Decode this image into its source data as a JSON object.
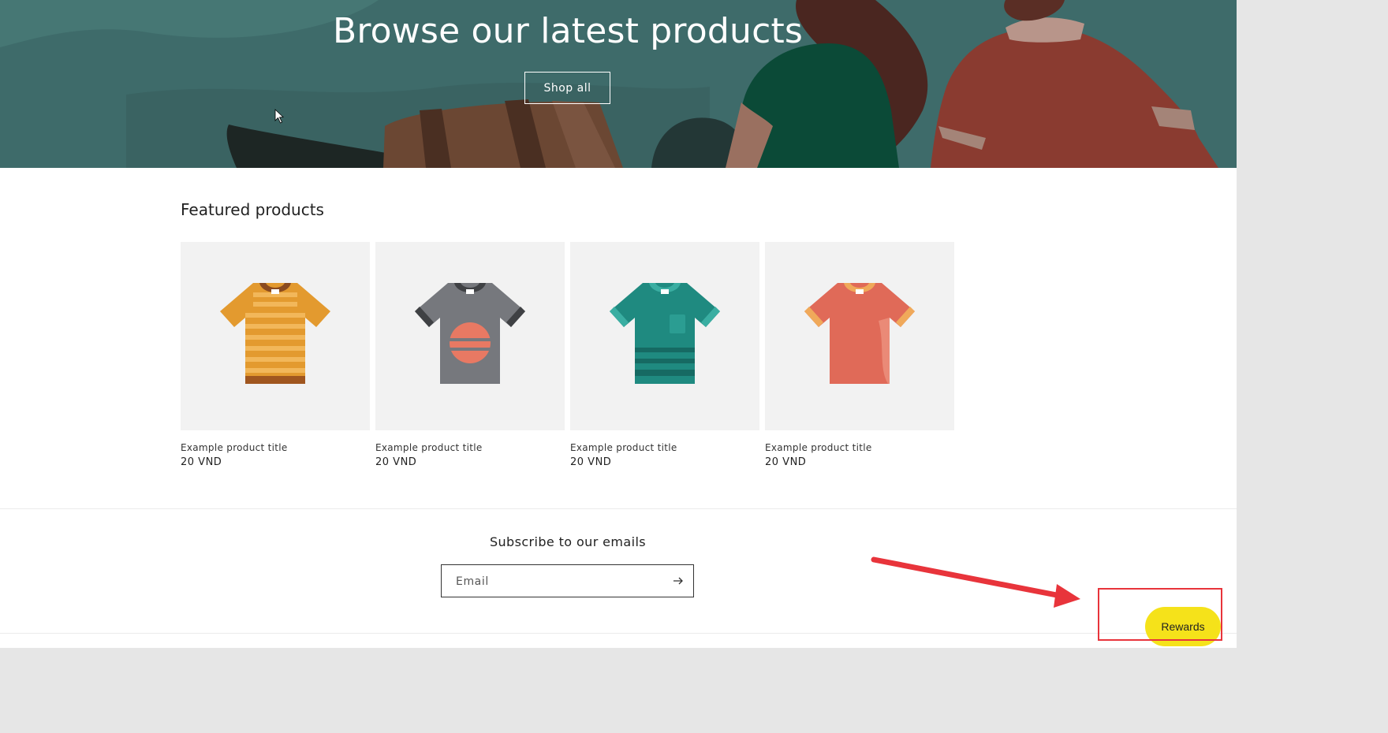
{
  "hero": {
    "title": "Browse our latest products",
    "button_label": "Shop all"
  },
  "featured": {
    "title": "Featured products",
    "products": [
      {
        "title": "Example product title",
        "price": "20 VND",
        "shirt": "striped-orange-shirt-icon"
      },
      {
        "title": "Example product title",
        "price": "20 VND",
        "shirt": "gray-sunset-shirt-icon"
      },
      {
        "title": "Example product title",
        "price": "20 VND",
        "shirt": "teal-pocket-shirt-icon"
      },
      {
        "title": "Example product title",
        "price": "20 VND",
        "shirt": "coral-shirt-icon"
      }
    ]
  },
  "newsletter": {
    "title": "Subscribe to our emails",
    "email_placeholder": "Email"
  },
  "rewards": {
    "label": "Rewards",
    "color": "#f5e21a"
  },
  "annotation": {
    "color": "#e8343b"
  }
}
